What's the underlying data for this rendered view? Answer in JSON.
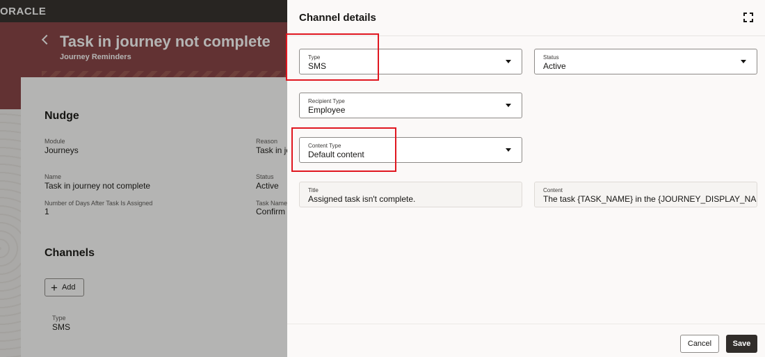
{
  "app": {
    "logo": "ORACLE"
  },
  "page": {
    "title": "Task in journey not complete",
    "subtitle": "Journey Reminders"
  },
  "nudge": {
    "heading": "Nudge",
    "fields": {
      "module": {
        "label": "Module",
        "value": "Journeys"
      },
      "reason": {
        "label": "Reason",
        "value": "Task in jo"
      },
      "name": {
        "label": "Name",
        "value": "Task in journey not complete"
      },
      "status": {
        "label": "Status",
        "value": "Active"
      },
      "days": {
        "label": "Number of Days After Task Is Assigned",
        "value": "1"
      },
      "task_name": {
        "label": "Task Name",
        "value": "Confirm"
      }
    }
  },
  "channels": {
    "heading": "Channels",
    "add_label": "Add",
    "type_label": "Type",
    "type_value": "SMS"
  },
  "drawer": {
    "title": "Channel details",
    "type": {
      "label": "Type",
      "value": "SMS"
    },
    "status": {
      "label": "Status",
      "value": "Active"
    },
    "recipient_type": {
      "label": "Recipient Type",
      "value": "Employee"
    },
    "content_type": {
      "label": "Content Type",
      "value": "Default content"
    },
    "title_field": {
      "label": "Title",
      "value": "Assigned task isn't complete."
    },
    "content_field": {
      "label": "Content",
      "value": "The task {TASK_NAME} in the {JOURNEY_DISPLAY_NAME"
    },
    "cancel_label": "Cancel",
    "save_label": "Save"
  },
  "colors": {
    "topbar": "#312d2a",
    "hero": "#874043",
    "highlight": "#e0161f",
    "primary_button": "#312d2a"
  },
  "icons": [
    "back-chevron-icon",
    "expand-icon",
    "plus-icon",
    "chevron-down-icon"
  ]
}
